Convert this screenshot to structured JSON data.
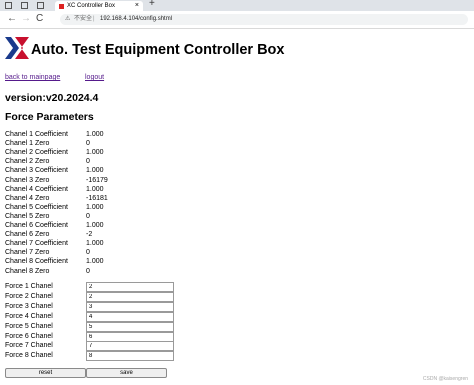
{
  "browser": {
    "tab_title": "XC Controller Box",
    "tab_close": "×",
    "new_tab": "+",
    "back": "←",
    "forward": "→",
    "reload": "C",
    "home": "⌂",
    "insecure_label": "不安全",
    "separator": "|",
    "url": "192.168.4.104/config.shtml"
  },
  "page": {
    "title": "Auto. Test Equipment Controller Box",
    "back_link": "back to mainpage",
    "logout_link": "logout",
    "version": "version:v20.2024.4",
    "section_title": "Force Parameters",
    "brand_color": "#c8102e",
    "logo_color": "#1a3a8c"
  },
  "params": [
    {
      "label": "Chanel 1 Coefficient",
      "value": "1.000"
    },
    {
      "label": "Chanel 1 Zero",
      "value": "0"
    },
    {
      "label": "Chanel 2 Coefficient",
      "value": "1.000"
    },
    {
      "label": "Chanel 2 Zero",
      "value": "0"
    },
    {
      "label": "Chanel 3 Coefficient",
      "value": "1.000"
    },
    {
      "label": "Chanel 3 Zero",
      "value": "-16179"
    },
    {
      "label": "Chanel 4 Coefficient",
      "value": "1.000"
    },
    {
      "label": "Chanel 4 Zero",
      "value": "-16181"
    },
    {
      "label": "Chanel 5 Coefficient",
      "value": "1.000"
    },
    {
      "label": "Chanel 5 Zero",
      "value": "0"
    },
    {
      "label": "Chanel 6 Coefficient",
      "value": "1.000"
    },
    {
      "label": "Chanel 6 Zero",
      "value": "-2"
    },
    {
      "label": "Chanel 7 Coefficient",
      "value": "1.000"
    },
    {
      "label": "Chanel 7 Zero",
      "value": "0"
    },
    {
      "label": "Chanel 8 Coefficient",
      "value": "1.000"
    },
    {
      "label": "Chanel 8 Zero",
      "value": "0"
    }
  ],
  "forces": [
    {
      "label": "Force 1 Chanel",
      "value": "2"
    },
    {
      "label": "Force 2 Chanel",
      "value": "2"
    },
    {
      "label": "Force 3 Chanel",
      "value": "3"
    },
    {
      "label": "Force 4 Chanel",
      "value": "4"
    },
    {
      "label": "Force 5 Chanel",
      "value": "5"
    },
    {
      "label": "Force 6 Chanel",
      "value": "6"
    },
    {
      "label": "Force 7 Chanel",
      "value": "7"
    },
    {
      "label": "Force 8 Chanel",
      "value": "8"
    }
  ],
  "buttons": {
    "reset": "reset",
    "save": "save"
  },
  "watermark": "CSDN @kaisengren"
}
